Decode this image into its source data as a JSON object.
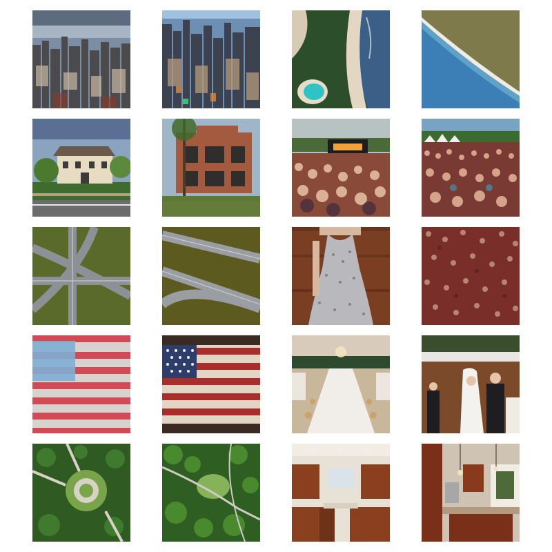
{
  "grid": {
    "rows": 5,
    "cols": 4,
    "images": [
      {
        "subject": "city-skyline"
      },
      {
        "subject": "city-skyline-dense"
      },
      {
        "subject": "aerial-beach-lagoon"
      },
      {
        "subject": "aerial-coastline"
      },
      {
        "subject": "suburban-house"
      },
      {
        "subject": "modern-brick-house"
      },
      {
        "subject": "concert-crowd-stage"
      },
      {
        "subject": "festival-crowd"
      },
      {
        "subject": "highway-interchange"
      },
      {
        "subject": "highway-aerial"
      },
      {
        "subject": "floral-dress"
      },
      {
        "subject": "floral-fabric"
      },
      {
        "subject": "flag-faded"
      },
      {
        "subject": "american-flag-grunge"
      },
      {
        "subject": "banquet-hall"
      },
      {
        "subject": "wedding-couple"
      },
      {
        "subject": "aerial-park-roundabout"
      },
      {
        "subject": "aerial-park-paths"
      },
      {
        "subject": "wooden-kitchen"
      },
      {
        "subject": "kitchen-island"
      }
    ]
  },
  "colors": {
    "background": "#ffffff"
  }
}
